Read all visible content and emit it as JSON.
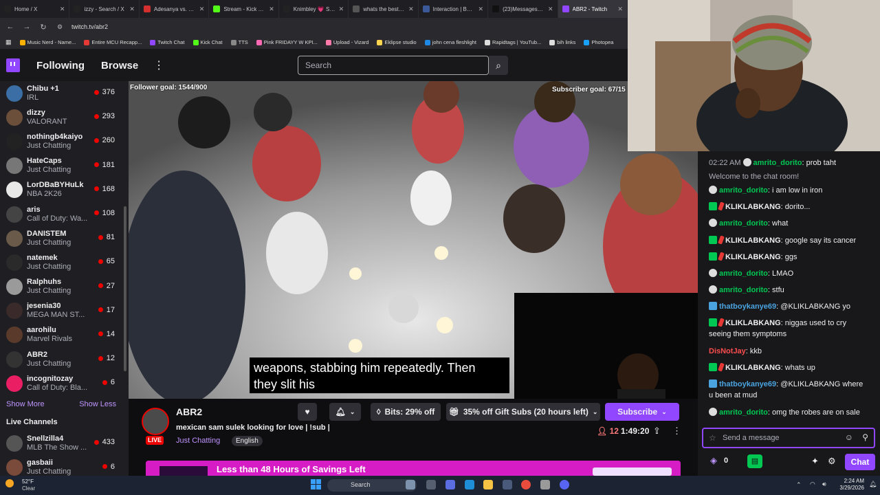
{
  "browser": {
    "tabs": [
      {
        "title": "Home / X",
        "color": "#222222"
      },
      {
        "title": "izzy - Search / X",
        "color": "#222222"
      },
      {
        "title": "Adesanya vs. Pyfer",
        "color": "#d32f2f"
      },
      {
        "title": "Stream - Kick Das...",
        "color": "#53fc18"
      },
      {
        "title": "Knimbley 💗 Sub...",
        "color": "#222222"
      },
      {
        "title": "whats the best fin...",
        "color": "#555555"
      },
      {
        "title": "Interaction | BotR...",
        "color": "#3b5998"
      },
      {
        "title": "(23)Messages | Ti...",
        "color": "#111111"
      },
      {
        "title": "ABR2 - Twitch",
        "color": "#9147ff"
      }
    ],
    "url": "twitch.tv/abr2",
    "bookmarks": [
      {
        "label": "Music Nerd - Name...",
        "color": "#ffb300"
      },
      {
        "label": "Entire MCU Recapp...",
        "color": "#e53935"
      },
      {
        "label": "Twitch Chat",
        "color": "#9147ff"
      },
      {
        "label": "Kick Chat",
        "color": "#53fc18"
      },
      {
        "label": "TTS",
        "color": "#888888"
      },
      {
        "label": "Pink FRIDAYY W KPI...",
        "color": "#ff69b4"
      },
      {
        "label": "Upload - Vizard",
        "color": "#ff7aa8"
      },
      {
        "label": "Eklipse studio",
        "color": "#ffd54f"
      },
      {
        "label": "john cena fleshlight",
        "color": "#1e88e5"
      },
      {
        "label": "Rapidtags | YouTub...",
        "color": "#dddddd"
      },
      {
        "label": "bih links",
        "color": "#dddddd"
      },
      {
        "label": "Photopea",
        "color": "#18a0fb"
      }
    ]
  },
  "nav": {
    "following": "Following",
    "browse": "Browse",
    "more": "⋮",
    "search_placeholder": "Search"
  },
  "sidebar": {
    "channels": [
      {
        "name": "Chibu +1",
        "category": "IRL",
        "viewers": "376",
        "color": "#3a6ea5"
      },
      {
        "name": "dizzy",
        "category": "VALORANT",
        "viewers": "293",
        "color": "#6b4f3a"
      },
      {
        "name": "nothingb4kaiyo",
        "category": "Just Chatting",
        "viewers": "260",
        "color": "#222222"
      },
      {
        "name": "HateCaps",
        "category": "Just Chatting",
        "viewers": "181",
        "color": "#777777"
      },
      {
        "name": "LorDBaBYHuLk",
        "category": "NBA 2K26",
        "viewers": "168",
        "color": "#e8e8e8"
      },
      {
        "name": "aris",
        "category": "Call of Duty: Wa...",
        "viewers": "108",
        "color": "#444444"
      },
      {
        "name": "DANISTEM",
        "category": "Just Chatting",
        "viewers": "81",
        "color": "#6a5a4a"
      },
      {
        "name": "natemek",
        "category": "Just Chatting",
        "viewers": "65",
        "color": "#2a2a2a"
      },
      {
        "name": "Ralphuhs",
        "category": "Just Chatting",
        "viewers": "27",
        "color": "#9a9a9a"
      },
      {
        "name": "jesenia30",
        "category": "MEGA MAN ST...",
        "viewers": "17",
        "color": "#3a2a2a"
      },
      {
        "name": "aarohilu",
        "category": "Marvel Rivals",
        "viewers": "14",
        "color": "#5a3a2a"
      },
      {
        "name": "ABR2",
        "category": "Just Chatting",
        "viewers": "12",
        "color": "#333333"
      },
      {
        "name": "incognitozay",
        "category": "Call of Duty: Bla...",
        "viewers": "6",
        "color": "#e91e63"
      }
    ],
    "show_more": "Show More",
    "show_less": "Show Less",
    "live_channels": "Live Channels",
    "live": [
      {
        "name": "Snellzilla4",
        "category": "MLB The Show ...",
        "viewers": "433",
        "color": "#555555"
      },
      {
        "name": "gasbaii",
        "category": "Just Chatting",
        "viewers": "6",
        "color": "#7a4a3a"
      }
    ]
  },
  "video": {
    "follower_goal": "Follower goal: 1544/900",
    "subscriber_goal": "Subscriber goal: 67/15",
    "caption_line1": "weapons, stabbing him repeatedly. Then",
    "caption_line2": "they slit his"
  },
  "stream": {
    "name": "ABR2",
    "title": "mexican sam sulek looking for love | !sub |",
    "category": "Just Chatting",
    "tag": "English",
    "live_label": "LIVE",
    "bits": "Bits: 29% off",
    "gift": "35% off Gift Subs (20 hours left)",
    "subscribe": "Subscribe",
    "viewers": "12",
    "uptime": "1:49:20",
    "banner": "Less than 48 Hours of Savings Left"
  },
  "chat": {
    "messages": [
      {
        "time": "02:22 AM",
        "user": "amrito_dorito",
        "text": "prob taht",
        "color": "#00c853",
        "badge": "skull"
      },
      {
        "user": "",
        "text": "Welcome to the chat room!",
        "color": "#adadb8",
        "badge": ""
      },
      {
        "user": "amrito_dorito",
        "text": "i am low in iron",
        "color": "#00c853",
        "badge": "skull"
      },
      {
        "user": "KLIKLABKANG",
        "text": "dorito...",
        "color": "#efeff1",
        "badge": "mod"
      },
      {
        "user": "amrito_dorito",
        "text": "what",
        "color": "#00c853",
        "badge": "skull"
      },
      {
        "user": "KLIKLABKANG",
        "text": "google say its cancer",
        "color": "#efeff1",
        "badge": "mod"
      },
      {
        "user": "KLIKLABKANG",
        "text": "ggs",
        "color": "#efeff1",
        "badge": "mod"
      },
      {
        "user": "amrito_dorito",
        "text": "LMAO",
        "color": "#00c853",
        "badge": "skull"
      },
      {
        "user": "amrito_dorito",
        "text": "stfu",
        "color": "#00c853",
        "badge": "skull"
      },
      {
        "user": "thatboykanye69",
        "text": "@KLIKLABKANG yo",
        "color": "#4aa3df",
        "badge": "blue"
      },
      {
        "user": "KLIKLABKANG",
        "text": "niggas used to cry seeing them symptoms",
        "color": "#efeff1",
        "badge": "mod"
      },
      {
        "user": "DisNotJay",
        "text": "kkb",
        "color": "#ff4d4d",
        "badge": ""
      },
      {
        "user": "KLIKLABKANG",
        "text": "whats up",
        "color": "#efeff1",
        "badge": "mod"
      },
      {
        "user": "thatboykanye69",
        "text": "@KLIKLABKANG where u been at mud",
        "color": "#4aa3df",
        "badge": "blue"
      },
      {
        "user": "amrito_dorito",
        "text": "omg the robes are on sale",
        "color": "#00c853",
        "badge": "skull"
      }
    ],
    "input_placeholder": "Send a message",
    "points": "0",
    "chat_button": "Chat"
  },
  "taskbar": {
    "weather_temp": "52°F",
    "weather_desc": "Clear",
    "search": "Search",
    "time": "2:24 AM",
    "date": "3/29/2026"
  }
}
